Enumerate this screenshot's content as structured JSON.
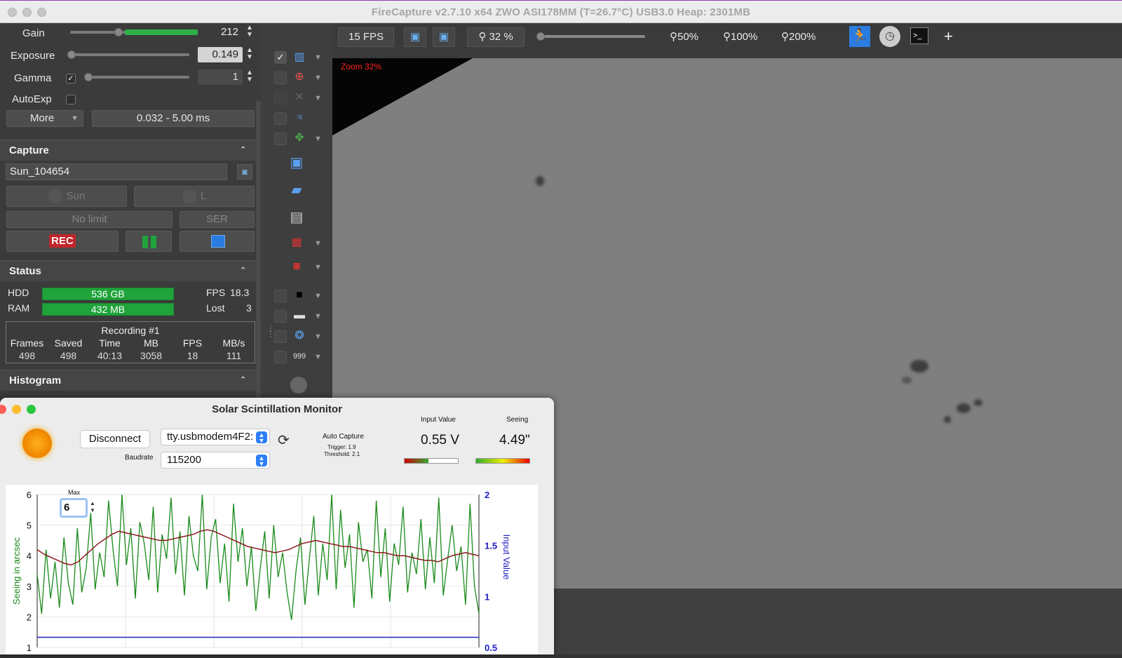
{
  "window": {
    "title": "FireCapture v2.7.10 x64    ZWO ASI178MM (T=26.7°C) USB3.0     Heap: 2301MB"
  },
  "controls": {
    "gain": {
      "label": "Gain",
      "value": "212",
      "level": 0.62
    },
    "exposure": {
      "label": "Exposure",
      "value": "0.149",
      "level": 0.0
    },
    "gamma": {
      "label": "Gamma",
      "value": "1",
      "checked": true
    },
    "autoexp": {
      "label": "AutoExp",
      "checked": false
    },
    "more_label": "More",
    "range_text": "0.032 - 5.00 ms"
  },
  "capture": {
    "title": "Capture",
    "filename": "Sun_104654",
    "object_label": "Sun",
    "filter_label": "L",
    "limit_label": "No limit",
    "format_label": "SER",
    "rec_label": "REC"
  },
  "status": {
    "title": "Status",
    "hdd_label": "HDD",
    "hdd_value": "536 GB",
    "ram_label": "RAM",
    "ram_value": "432 MB",
    "fps_label": "FPS",
    "fps_value": "18.3",
    "lost_label": "Lost",
    "lost_value": "3",
    "recording_title": "Recording #1",
    "headers": [
      "Frames",
      "Saved",
      "Time",
      "MB",
      "FPS",
      "MB/s"
    ],
    "values": [
      "498",
      "498",
      "40:13",
      "3058",
      "18",
      "111"
    ]
  },
  "histogram": {
    "title": "Histogram"
  },
  "toolbar": {
    "fps": "15 FPS",
    "zoom_current": "32 %",
    "zoom50": "50%",
    "zoom100": "100%",
    "zoom200": "200%",
    "plus": "+"
  },
  "viewer": {
    "zoom_text": "Zoom 32%"
  },
  "ssm": {
    "title": "Solar Scintillation Monitor",
    "disconnect": "Disconnect",
    "port": "tty.usbmodem4F2:",
    "baudrate_label": "Baudrate",
    "baudrate": "115200",
    "auto_capture": "Auto Capture",
    "trigger": "Trigger: 1.9",
    "threshold": "Threshold: 2.1",
    "input_value_label": "Input Value",
    "input_value": "0.55 V",
    "seeing_label": "Seeing",
    "seeing_value": "4.49\"",
    "max_label": "Max",
    "max_value": "6"
  },
  "chart_data": {
    "type": "line",
    "ylabel": "Seeing in arcsec",
    "y2label": "Input Value",
    "ylim": [
      1,
      6
    ],
    "y2lim": [
      0.5,
      2
    ],
    "yticks": [
      "6",
      "5",
      "4",
      "3",
      "2",
      "1"
    ],
    "y2ticks": [
      "2",
      "1.5",
      "1",
      "0.5"
    ],
    "series": [
      {
        "color": "#1a8a1a",
        "values": [
          3.4,
          2.1,
          4.2,
          2.6,
          3.8,
          2.3,
          4.6,
          3.1,
          2.4,
          4.9,
          2.8,
          3.6,
          5.4,
          2.9,
          4.1,
          3.3,
          5.8,
          4.2,
          3.0,
          6.2,
          3.7,
          4.9,
          2.6,
          5.1,
          4.4,
          3.2,
          5.6,
          2.8,
          4.7,
          3.9,
          5.9,
          3.4,
          4.8,
          2.7,
          5.3,
          4.0,
          3.5,
          6.1,
          2.9,
          4.6,
          5.2,
          3.1,
          4.4,
          2.5,
          5.7,
          3.8,
          4.9,
          3.0,
          4.3,
          2.2,
          3.6,
          4.8,
          2.6,
          5.0,
          3.3,
          4.1,
          2.8,
          1.9,
          3.5,
          4.6,
          2.4,
          3.9,
          5.3,
          2.7,
          4.4,
          3.2,
          6.0,
          2.9,
          5.5,
          3.6,
          4.7,
          2.3,
          5.1,
          3.8,
          4.2,
          2.6,
          5.8,
          3.3,
          4.9,
          2.5,
          4.4,
          3.7,
          5.6,
          2.8,
          4.1,
          3.4,
          5.2,
          2.9,
          4.6,
          3.1,
          5.9,
          2.7,
          3.9,
          5.0,
          3.5,
          4.3,
          2.4,
          5.7,
          3.0,
          2.1
        ]
      },
      {
        "color": "#8b1a1a",
        "values": [
          4.2,
          4.05,
          3.95,
          3.85,
          3.75,
          3.7,
          3.8,
          4.0,
          4.2,
          4.4,
          4.55,
          4.7,
          4.8,
          4.75,
          4.7,
          4.65,
          4.6,
          4.55,
          4.5,
          4.5,
          4.55,
          4.6,
          4.65,
          4.7,
          4.8,
          4.85,
          4.8,
          4.7,
          4.6,
          4.5,
          4.4,
          4.3,
          4.25,
          4.2,
          4.15,
          4.1,
          4.15,
          4.2,
          4.3,
          4.4,
          4.45,
          4.5,
          4.45,
          4.4,
          4.35,
          4.3,
          4.3,
          4.25,
          4.2,
          4.15,
          4.1,
          4.1,
          4.05,
          4.0,
          4.0,
          3.95,
          3.9,
          3.85,
          3.85,
          3.8,
          3.9,
          4.0,
          4.05,
          4.1,
          4.05,
          4.0
        ]
      },
      {
        "color": "#2020c0",
        "values": [
          0.6,
          0.6,
          0.6,
          0.6,
          0.6,
          0.6,
          0.6,
          0.6,
          0.6,
          0.6,
          0.6,
          0.6,
          0.6,
          0.6,
          0.6,
          0.6,
          0.6,
          0.6,
          0.6,
          0.6,
          0.6,
          0.6,
          0.6,
          0.6,
          0.6,
          0.6,
          0.6,
          0.6,
          0.6,
          0.6,
          0.6,
          0.6,
          0.6,
          0.6,
          0.6,
          0.6,
          0.6,
          0.6,
          0.6,
          0.6,
          0.6,
          0.6,
          0.6,
          0.6,
          0.6,
          0.6,
          0.6,
          0.6,
          0.6,
          0.6
        ]
      }
    ]
  }
}
